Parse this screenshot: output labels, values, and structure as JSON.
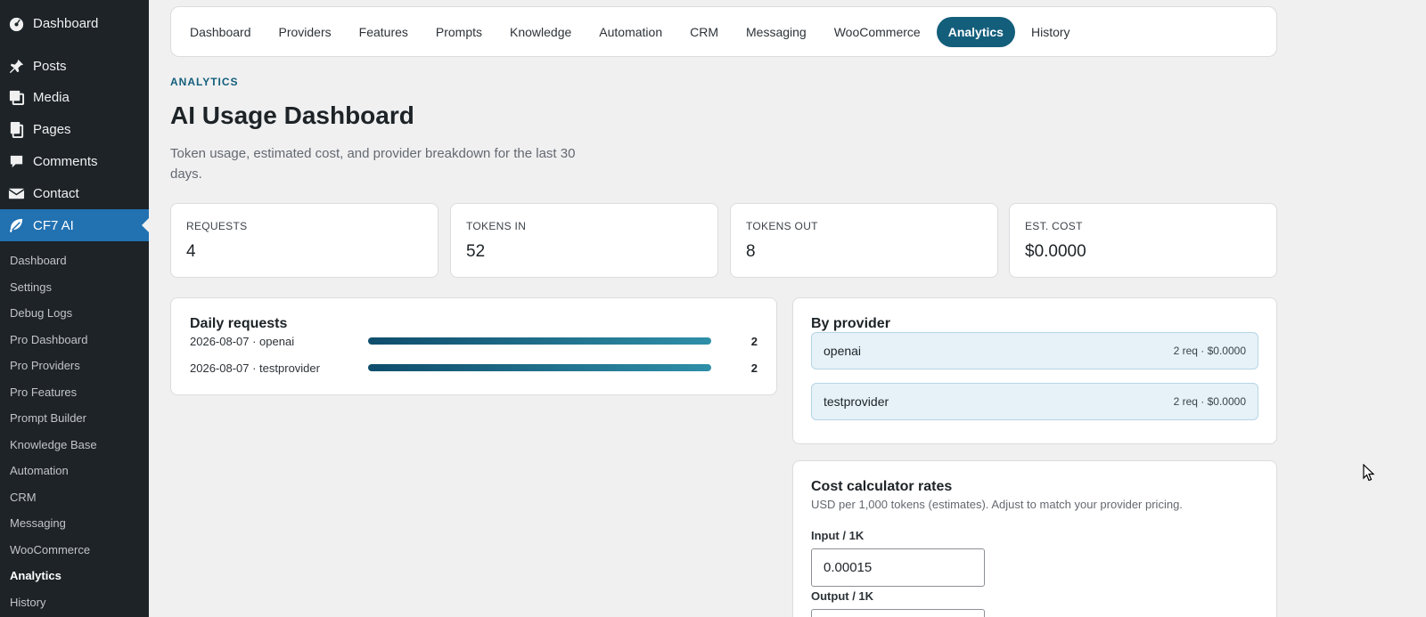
{
  "sidebar": {
    "top_items": [
      {
        "label": "Dashboard",
        "icon": "dashboard-icon"
      },
      {
        "label": "Posts",
        "icon": "pin-icon"
      },
      {
        "label": "Media",
        "icon": "media-icon"
      },
      {
        "label": "Pages",
        "icon": "pages-icon"
      },
      {
        "label": "Comments",
        "icon": "comments-icon"
      },
      {
        "label": "Contact",
        "icon": "mail-icon"
      },
      {
        "label": "CF7 AI",
        "icon": "leaf-icon"
      }
    ],
    "sub_items": [
      "Dashboard",
      "Settings",
      "Debug Logs",
      "Pro Dashboard",
      "Pro Providers",
      "Pro Features",
      "Prompt Builder",
      "Knowledge Base",
      "Automation",
      "CRM",
      "Messaging",
      "WooCommerce",
      "Analytics",
      "History"
    ],
    "active_top": "CF7 AI",
    "current_sub": "Analytics"
  },
  "tabs": [
    "Dashboard",
    "Providers",
    "Features",
    "Prompts",
    "Knowledge",
    "Automation",
    "CRM",
    "Messaging",
    "WooCommerce",
    "Analytics",
    "History"
  ],
  "active_tab": "Analytics",
  "header": {
    "eyebrow": "ANALYTICS",
    "title": "AI Usage Dashboard",
    "subtitle": "Token usage, estimated cost, and provider breakdown for the last 30 days."
  },
  "stats": [
    {
      "label": "REQUESTS",
      "value": "4"
    },
    {
      "label": "TOKENS IN",
      "value": "52"
    },
    {
      "label": "TOKENS OUT",
      "value": "8"
    },
    {
      "label": "EST. COST",
      "value": "$0.0000"
    }
  ],
  "daily": {
    "title": "Daily requests",
    "rows": [
      {
        "label": "2026-08-07 · openai",
        "count": "2",
        "fraction": 1.0
      },
      {
        "label": "2026-08-07 · testprovider",
        "count": "2",
        "fraction": 1.0
      }
    ]
  },
  "by_provider": {
    "title": "By provider",
    "rows": [
      {
        "name": "openai",
        "stat": "2 req · $0.0000"
      },
      {
        "name": "testprovider",
        "stat": "2 req · $0.0000"
      }
    ]
  },
  "calculator": {
    "title": "Cost calculator rates",
    "description": "USD per 1,000 tokens (estimates). Adjust to match your provider pricing.",
    "input_label": "Input / 1K",
    "input_value": "0.00015",
    "output_label": "Output / 1K"
  },
  "colors": {
    "accent": "#135e7b",
    "sidebar_active": "#2271b1",
    "sidebar_bg": "#1d2327"
  }
}
